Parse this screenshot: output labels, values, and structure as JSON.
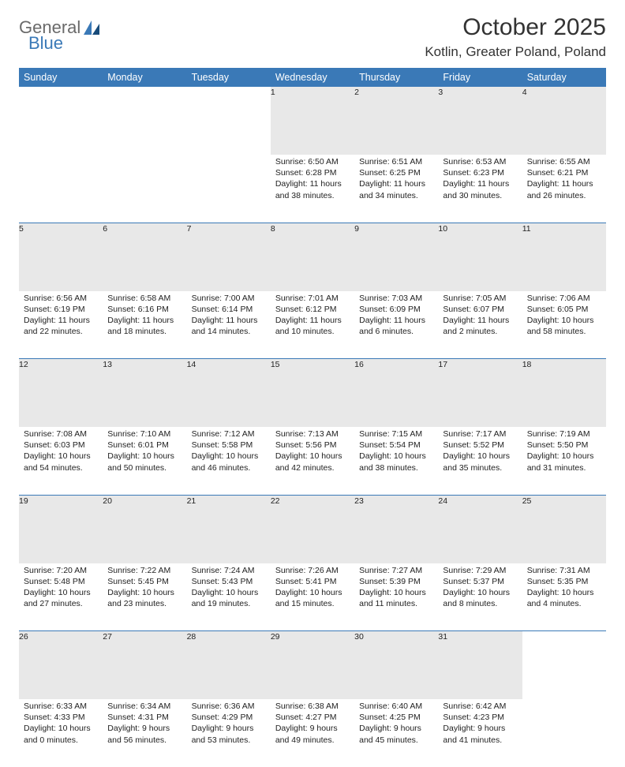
{
  "brand": {
    "top": "General",
    "bottom": "Blue"
  },
  "title": "October 2025",
  "location": "Kotlin, Greater Poland, Poland",
  "weekdays": [
    "Sunday",
    "Monday",
    "Tuesday",
    "Wednesday",
    "Thursday",
    "Friday",
    "Saturday"
  ],
  "weeks": [
    [
      null,
      null,
      null,
      {
        "n": "1",
        "sr": "6:50 AM",
        "ss": "6:28 PM",
        "dl": "11 hours and 38 minutes."
      },
      {
        "n": "2",
        "sr": "6:51 AM",
        "ss": "6:25 PM",
        "dl": "11 hours and 34 minutes."
      },
      {
        "n": "3",
        "sr": "6:53 AM",
        "ss": "6:23 PM",
        "dl": "11 hours and 30 minutes."
      },
      {
        "n": "4",
        "sr": "6:55 AM",
        "ss": "6:21 PM",
        "dl": "11 hours and 26 minutes."
      }
    ],
    [
      {
        "n": "5",
        "sr": "6:56 AM",
        "ss": "6:19 PM",
        "dl": "11 hours and 22 minutes."
      },
      {
        "n": "6",
        "sr": "6:58 AM",
        "ss": "6:16 PM",
        "dl": "11 hours and 18 minutes."
      },
      {
        "n": "7",
        "sr": "7:00 AM",
        "ss": "6:14 PM",
        "dl": "11 hours and 14 minutes."
      },
      {
        "n": "8",
        "sr": "7:01 AM",
        "ss": "6:12 PM",
        "dl": "11 hours and 10 minutes."
      },
      {
        "n": "9",
        "sr": "7:03 AM",
        "ss": "6:09 PM",
        "dl": "11 hours and 6 minutes."
      },
      {
        "n": "10",
        "sr": "7:05 AM",
        "ss": "6:07 PM",
        "dl": "11 hours and 2 minutes."
      },
      {
        "n": "11",
        "sr": "7:06 AM",
        "ss": "6:05 PM",
        "dl": "10 hours and 58 minutes."
      }
    ],
    [
      {
        "n": "12",
        "sr": "7:08 AM",
        "ss": "6:03 PM",
        "dl": "10 hours and 54 minutes."
      },
      {
        "n": "13",
        "sr": "7:10 AM",
        "ss": "6:01 PM",
        "dl": "10 hours and 50 minutes."
      },
      {
        "n": "14",
        "sr": "7:12 AM",
        "ss": "5:58 PM",
        "dl": "10 hours and 46 minutes."
      },
      {
        "n": "15",
        "sr": "7:13 AM",
        "ss": "5:56 PM",
        "dl": "10 hours and 42 minutes."
      },
      {
        "n": "16",
        "sr": "7:15 AM",
        "ss": "5:54 PM",
        "dl": "10 hours and 38 minutes."
      },
      {
        "n": "17",
        "sr": "7:17 AM",
        "ss": "5:52 PM",
        "dl": "10 hours and 35 minutes."
      },
      {
        "n": "18",
        "sr": "7:19 AM",
        "ss": "5:50 PM",
        "dl": "10 hours and 31 minutes."
      }
    ],
    [
      {
        "n": "19",
        "sr": "7:20 AM",
        "ss": "5:48 PM",
        "dl": "10 hours and 27 minutes."
      },
      {
        "n": "20",
        "sr": "7:22 AM",
        "ss": "5:45 PM",
        "dl": "10 hours and 23 minutes."
      },
      {
        "n": "21",
        "sr": "7:24 AM",
        "ss": "5:43 PM",
        "dl": "10 hours and 19 minutes."
      },
      {
        "n": "22",
        "sr": "7:26 AM",
        "ss": "5:41 PM",
        "dl": "10 hours and 15 minutes."
      },
      {
        "n": "23",
        "sr": "7:27 AM",
        "ss": "5:39 PM",
        "dl": "10 hours and 11 minutes."
      },
      {
        "n": "24",
        "sr": "7:29 AM",
        "ss": "5:37 PM",
        "dl": "10 hours and 8 minutes."
      },
      {
        "n": "25",
        "sr": "7:31 AM",
        "ss": "5:35 PM",
        "dl": "10 hours and 4 minutes."
      }
    ],
    [
      {
        "n": "26",
        "sr": "6:33 AM",
        "ss": "4:33 PM",
        "dl": "10 hours and 0 minutes."
      },
      {
        "n": "27",
        "sr": "6:34 AM",
        "ss": "4:31 PM",
        "dl": "9 hours and 56 minutes."
      },
      {
        "n": "28",
        "sr": "6:36 AM",
        "ss": "4:29 PM",
        "dl": "9 hours and 53 minutes."
      },
      {
        "n": "29",
        "sr": "6:38 AM",
        "ss": "4:27 PM",
        "dl": "9 hours and 49 minutes."
      },
      {
        "n": "30",
        "sr": "6:40 AM",
        "ss": "4:25 PM",
        "dl": "9 hours and 45 minutes."
      },
      {
        "n": "31",
        "sr": "6:42 AM",
        "ss": "4:23 PM",
        "dl": "9 hours and 41 minutes."
      },
      null
    ]
  ],
  "labels": {
    "sunrise": "Sunrise:",
    "sunset": "Sunset:",
    "daylight": "Daylight:"
  }
}
